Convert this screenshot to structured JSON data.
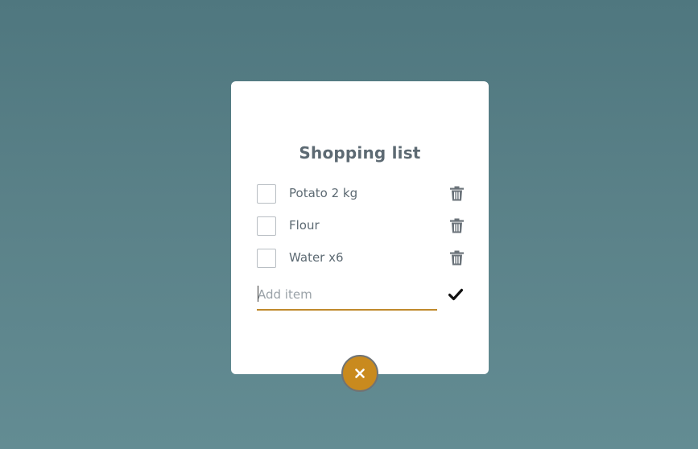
{
  "card": {
    "title": "Shopping list",
    "items": [
      {
        "label": "Potato 2 kg",
        "checked": false,
        "icon": "trash-icon"
      },
      {
        "label": "Flour",
        "checked": false,
        "icon": "trash-icon"
      },
      {
        "label": "Water x6",
        "checked": false,
        "icon": "trash-icon"
      }
    ],
    "add_item": {
      "placeholder": "Add item",
      "value": "",
      "confirm_icon": "checkmark-icon"
    }
  },
  "close_button": {
    "icon": "close-icon",
    "color": "#c98a1e"
  },
  "colors": {
    "background_top": "#4f777f",
    "background_bottom": "#638c93",
    "accent": "#c98a1e",
    "text": "#5d6a73"
  }
}
